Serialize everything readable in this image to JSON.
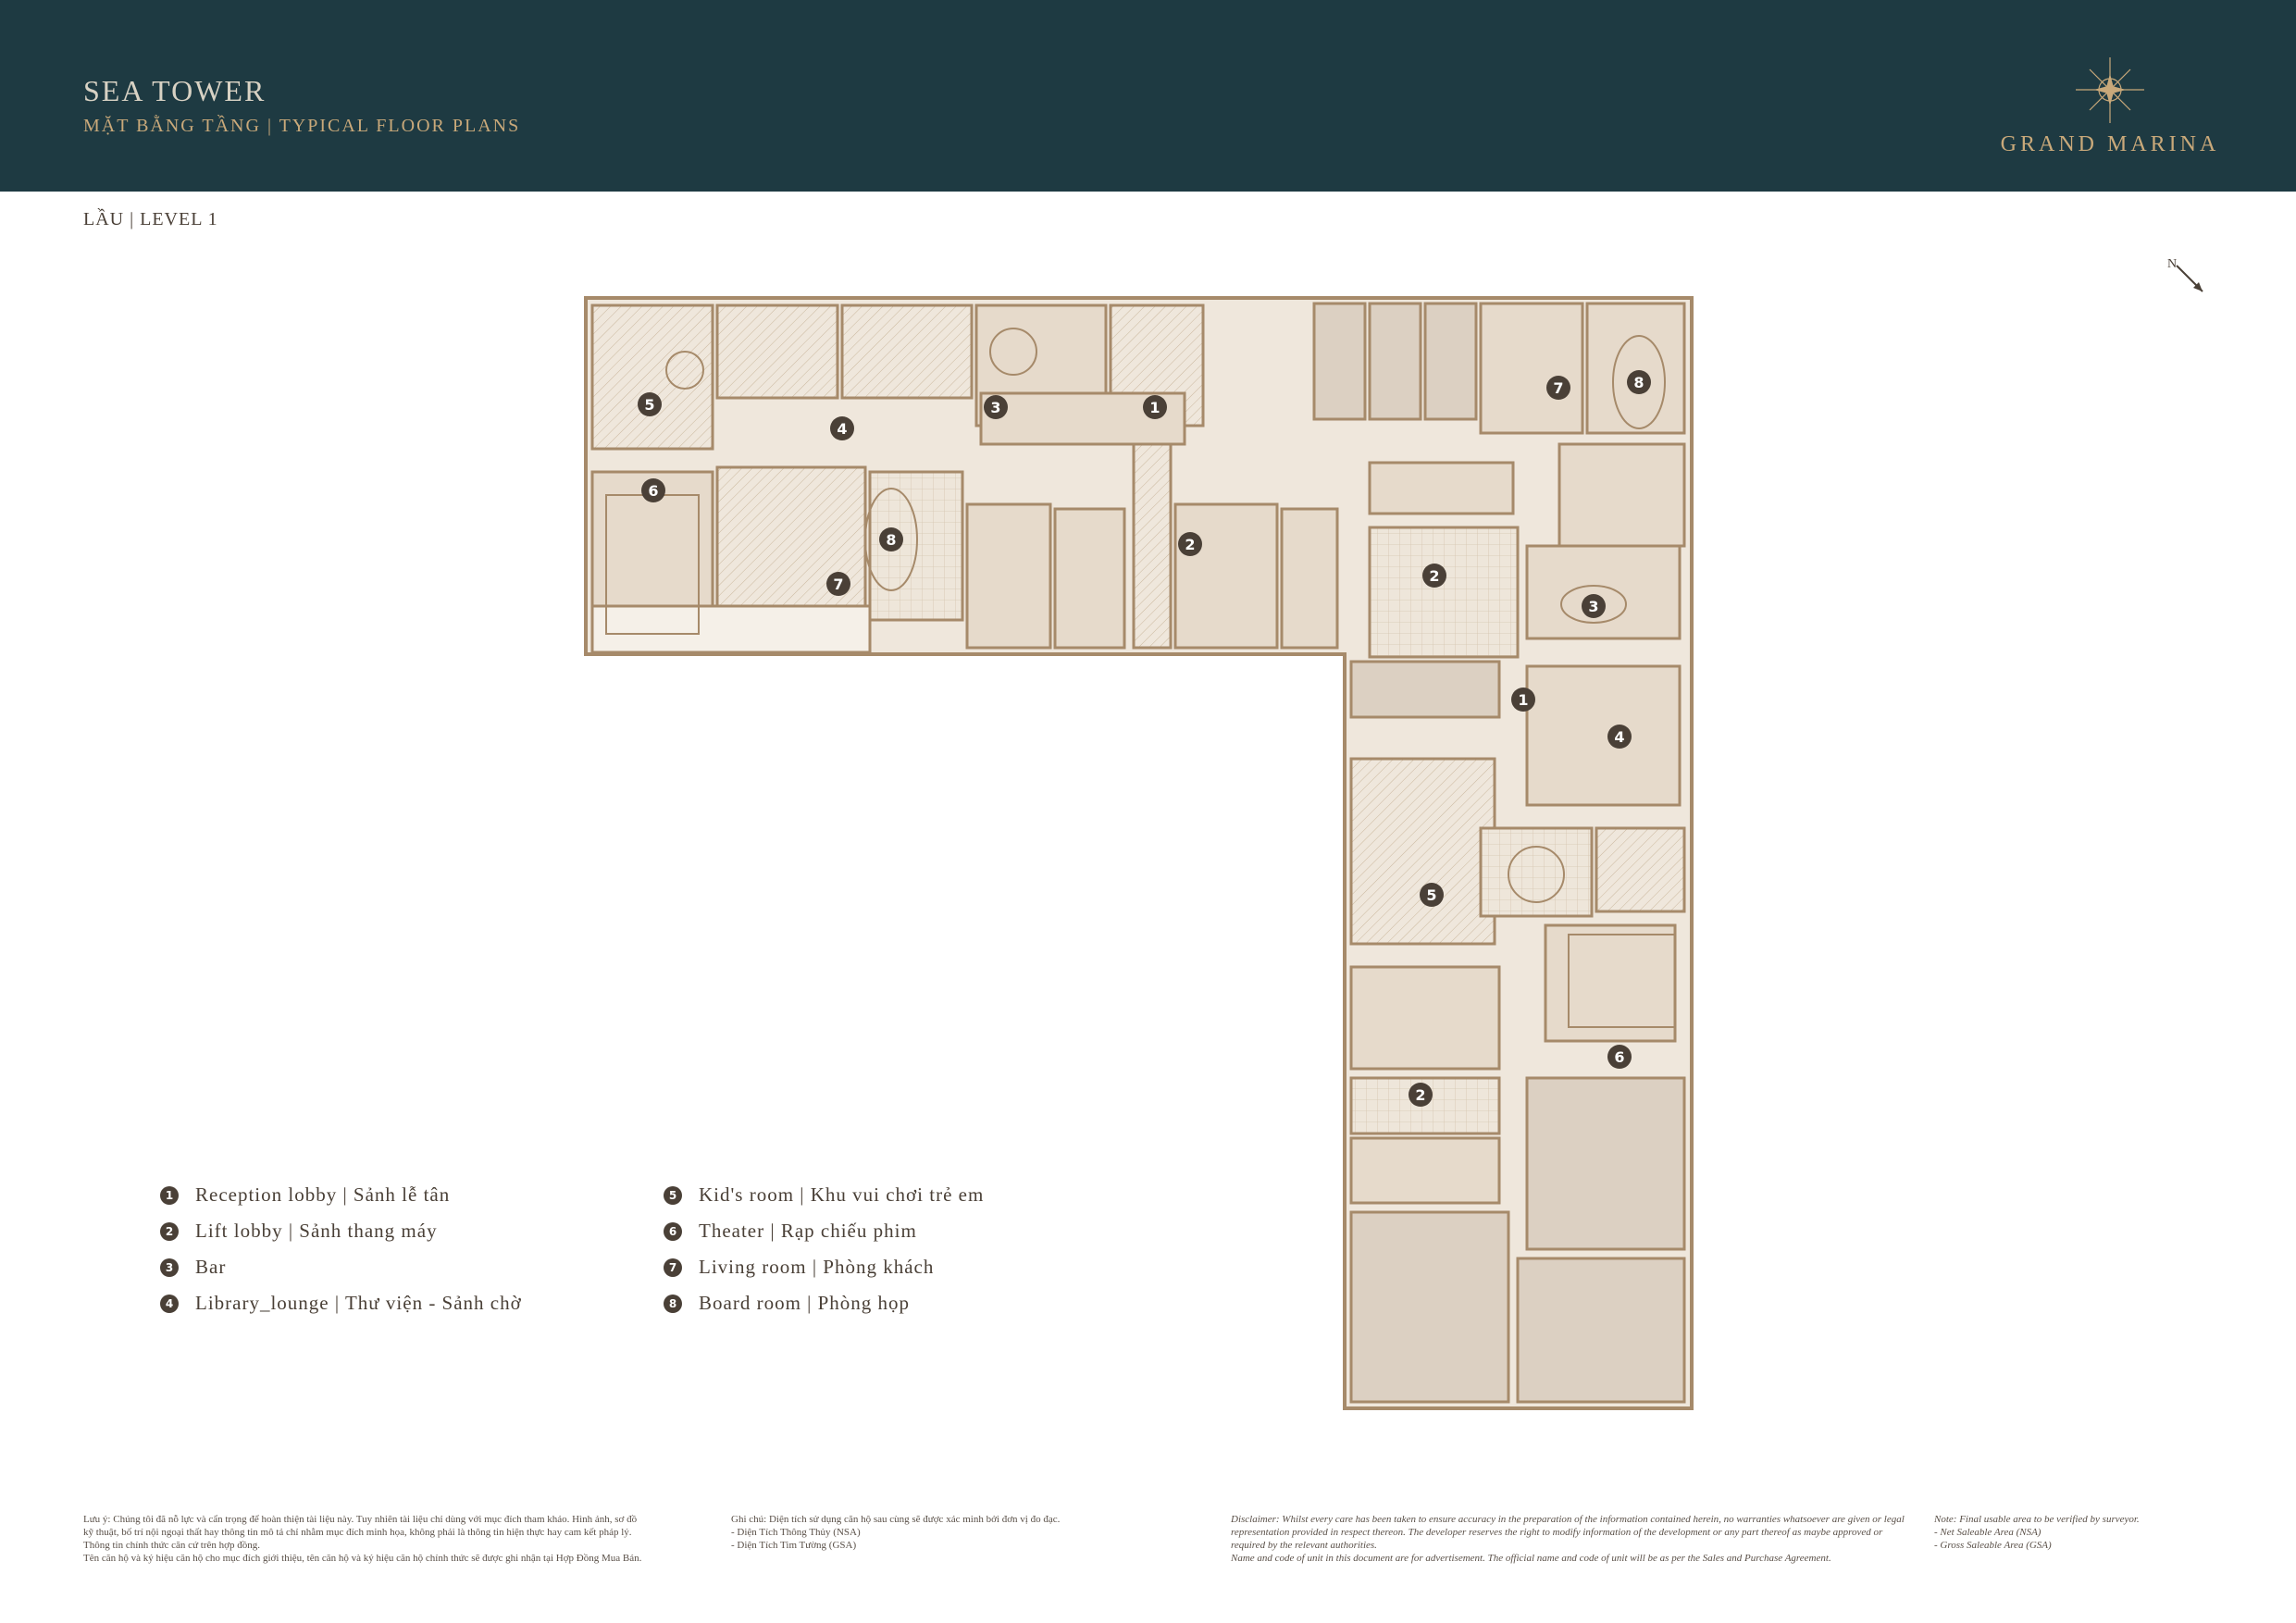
{
  "header": {
    "title": "SEA TOWER",
    "subtitle": "MẶT BẰNG TẦNG | TYPICAL FLOOR PLANS",
    "brand": "GRAND MARINA"
  },
  "level_label": "LẦU | LEVEL 1",
  "north_label": "N",
  "colors": {
    "header_bg": "#1e3a42",
    "gold": "#c9a97a",
    "plan_fill": "#e8ddd0",
    "plan_line": "#a68a6a",
    "marker": "#4a4037"
  },
  "legend": {
    "left": [
      {
        "num": "1",
        "label": "Reception lobby | Sảnh lễ tân"
      },
      {
        "num": "2",
        "label": "Lift lobby | Sảnh thang máy"
      },
      {
        "num": "3",
        "label": "Bar"
      },
      {
        "num": "4",
        "label": "Library_lounge | Thư viện - Sảnh chờ"
      }
    ],
    "right": [
      {
        "num": "5",
        "label": "Kid's room | Khu vui chơi trẻ em"
      },
      {
        "num": "6",
        "label": "Theater | Rạp chiếu phim"
      },
      {
        "num": "7",
        "label": "Living room | Phòng khách"
      },
      {
        "num": "8",
        "label": "Board room | Phòng họp"
      }
    ]
  },
  "plan_markers": [
    "5",
    "4",
    "3",
    "1",
    "6",
    "8",
    "7",
    "2",
    "8",
    "7",
    "2",
    "3",
    "1",
    "4",
    "5",
    "6",
    "2"
  ],
  "notes": {
    "vn_disclaimer": [
      "Lưu ý: Chúng tôi đã nỗ lực và cẩn trọng để hoàn thiện tài liệu này. Tuy nhiên tài liệu chỉ dùng với mục đích tham khảo. Hình ảnh, sơ đồ",
      "kỹ thuật, bố trí nội ngoại thất hay thông tin mô tả chỉ nhằm mục đích minh họa, không phải là thông tin hiện thực hay cam kết pháp lý.",
      "Thông tin chính thức căn cứ trên hợp đồng.",
      "Tên căn hộ và ký hiệu căn hộ cho mục đích giới thiệu, tên căn hộ và ký hiệu căn hộ chính thức sẽ được ghi nhận tại Hợp Đồng Mua Bán."
    ],
    "vn_area": [
      "Ghi chú: Diện tích sử dụng căn hộ sau cùng sẽ được xác minh bởi đơn vị đo đạc.",
      "- Diện Tích Thông Thủy (NSA)",
      "- Diện Tích Tim Tường (GSA)"
    ],
    "en_disclaimer": [
      "Disclaimer: Whilst every care has been taken to ensure accuracy in the preparation of the information contained herein, no warranties whatsoever are given or legal",
      "representation provided in respect thereon. The developer reserves the right to modify information of the development or any part thereof as maybe approved or",
      "required by the relevant authorities.",
      "Name and code of unit in this document are for advertisement. The official name and code of unit will be as per the Sales and Purchase Agreement."
    ],
    "en_area": [
      "Note: Final usable area to be verified by surveyor.",
      "- Net Saleable Area (NSA)",
      "- Gross Saleable Area (GSA)"
    ]
  }
}
